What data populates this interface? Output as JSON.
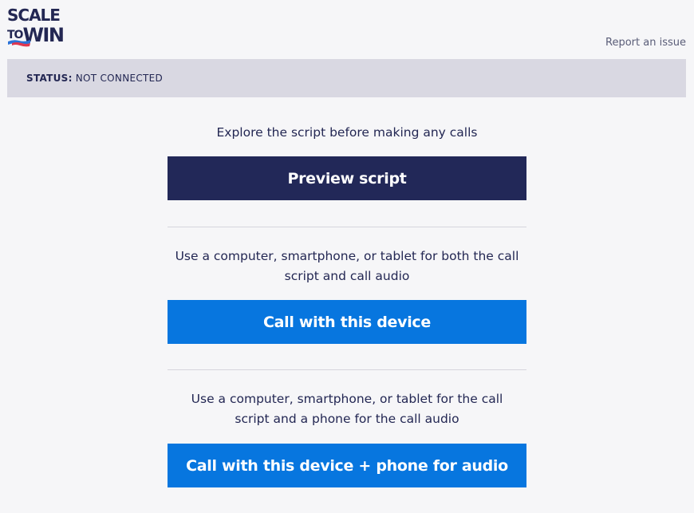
{
  "logo": {
    "line1": "SCALE",
    "to": "TO",
    "win": "WIN",
    "flag_icon": "us-flag-icon"
  },
  "header": {
    "report_link": "Report an issue"
  },
  "status": {
    "label": "STATUS:",
    "value": "NOT CONNECTED"
  },
  "sections": {
    "preview": {
      "description": "Explore the script before making any calls",
      "button_label": "Preview script"
    },
    "device": {
      "description_line1": "Use a computer, smartphone, or tablet for both the call",
      "description_line2": "script and call audio",
      "button_label": "Call with this device"
    },
    "device_phone": {
      "description_line1": "Use a computer, smartphone, or tablet for the call",
      "description_line2": "script and a phone for the call audio",
      "button_label": "Call with this device + phone for audio"
    }
  },
  "colors": {
    "navy": "#222858",
    "blue": "#0776df",
    "status_bg": "#d9d8e2",
    "page_bg": "#f6f6f8",
    "flag_red": "#e0374f",
    "flag_blue": "#2a72d8"
  }
}
